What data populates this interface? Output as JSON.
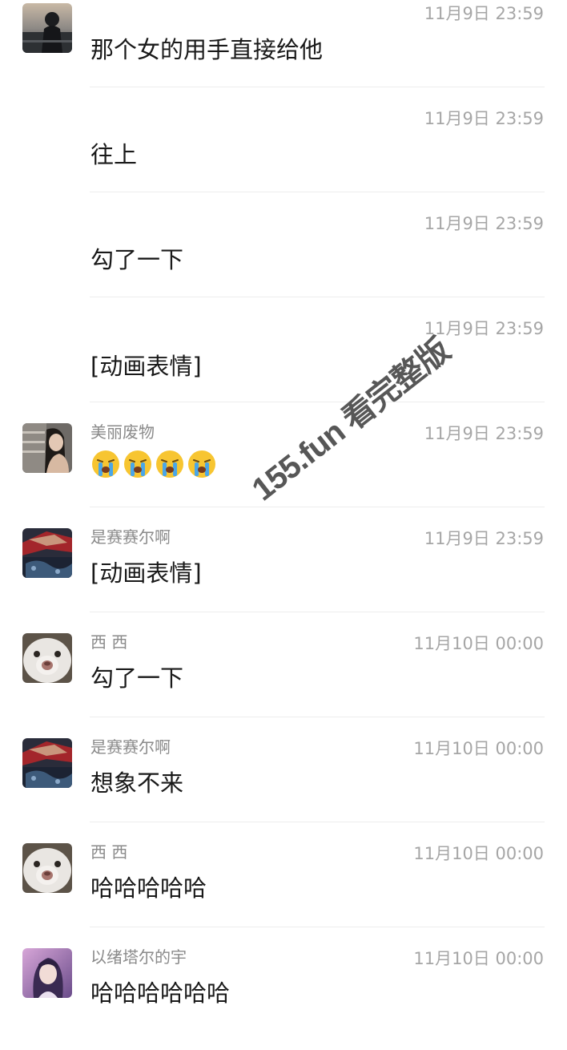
{
  "messages": [
    {
      "sender": "",
      "time": "11月9日 23:59",
      "text": "那个女的用手直接给他",
      "avatar": "avatar-dark-figure"
    },
    {
      "sender": "",
      "time": "11月9日 23:59",
      "text": "往上",
      "avatar": ""
    },
    {
      "sender": "",
      "time": "11月9日 23:59",
      "text": "勾了一下",
      "avatar": ""
    },
    {
      "sender": "",
      "time": "11月9日 23:59",
      "text": "[动画表情]",
      "avatar": ""
    },
    {
      "sender": "美丽废物",
      "time": "11月9日 23:59",
      "text": "",
      "emoji": [
        "crying-face-icon",
        "crying-face-icon",
        "crying-face-icon",
        "crying-face-icon"
      ],
      "avatar": "avatar-girl"
    },
    {
      "sender": "是赛赛尔啊",
      "time": "11月9日 23:59",
      "text": "[动画表情]",
      "avatar": "avatar-red-pattern"
    },
    {
      "sender": "西 西",
      "time": "11月10日 00:00",
      "text": "勾了一下",
      "avatar": "avatar-cat"
    },
    {
      "sender": "是赛赛尔啊",
      "time": "11月10日 00:00",
      "text": "想象不来",
      "avatar": "avatar-red-pattern"
    },
    {
      "sender": "西 西",
      "time": "11月10日 00:00",
      "text": "哈哈哈哈哈",
      "avatar": "avatar-cat"
    },
    {
      "sender": "以绪塔尔的宇",
      "time": "11月10日 00:00",
      "text": "哈哈哈哈哈哈",
      "avatar": "avatar-anime"
    }
  ],
  "watermark": "155.fun 看完整版"
}
